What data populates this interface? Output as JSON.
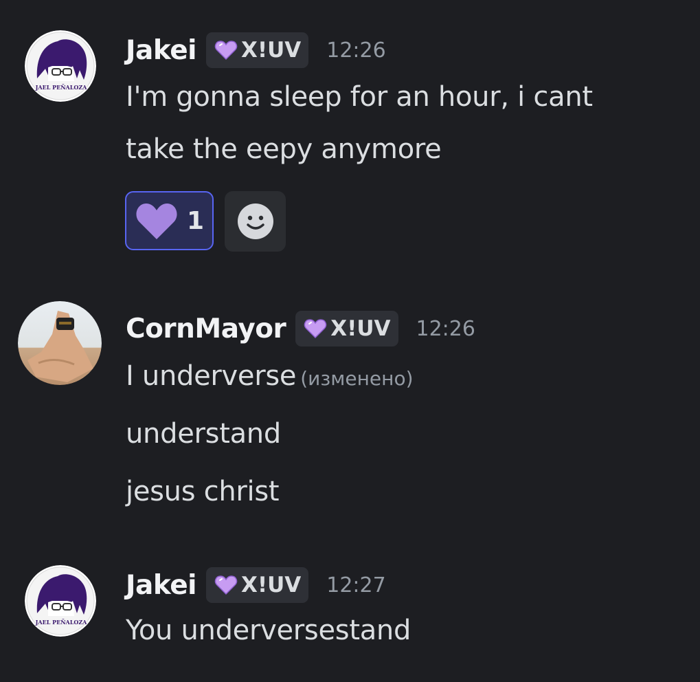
{
  "messages": [
    {
      "author": "Jakei",
      "tag": "X!UV",
      "time": "12:26",
      "avatar_text": "JAEL PEÑALOZA",
      "lines": [
        "I'm gonna sleep for an hour, i cant",
        "take the eepy anymore"
      ],
      "reaction": {
        "icon": "purple-heart-icon",
        "count": "1"
      }
    },
    {
      "author": "CornMayor",
      "tag": "X!UV",
      "time": "12:26",
      "lines": [
        "I underverse",
        "understand",
        "jesus christ"
      ],
      "edited_label": "(изменено)"
    },
    {
      "author": "Jakei",
      "tag": "X!UV",
      "time": "12:27",
      "avatar_text": "JAEL PEÑALOZA",
      "lines": [
        "You underversestand"
      ]
    }
  ],
  "colors": {
    "background": "#1d1e22",
    "tag_heart": "#c79cf2",
    "reaction_border": "#5865f2",
    "reaction_heart": "#a585e0"
  }
}
